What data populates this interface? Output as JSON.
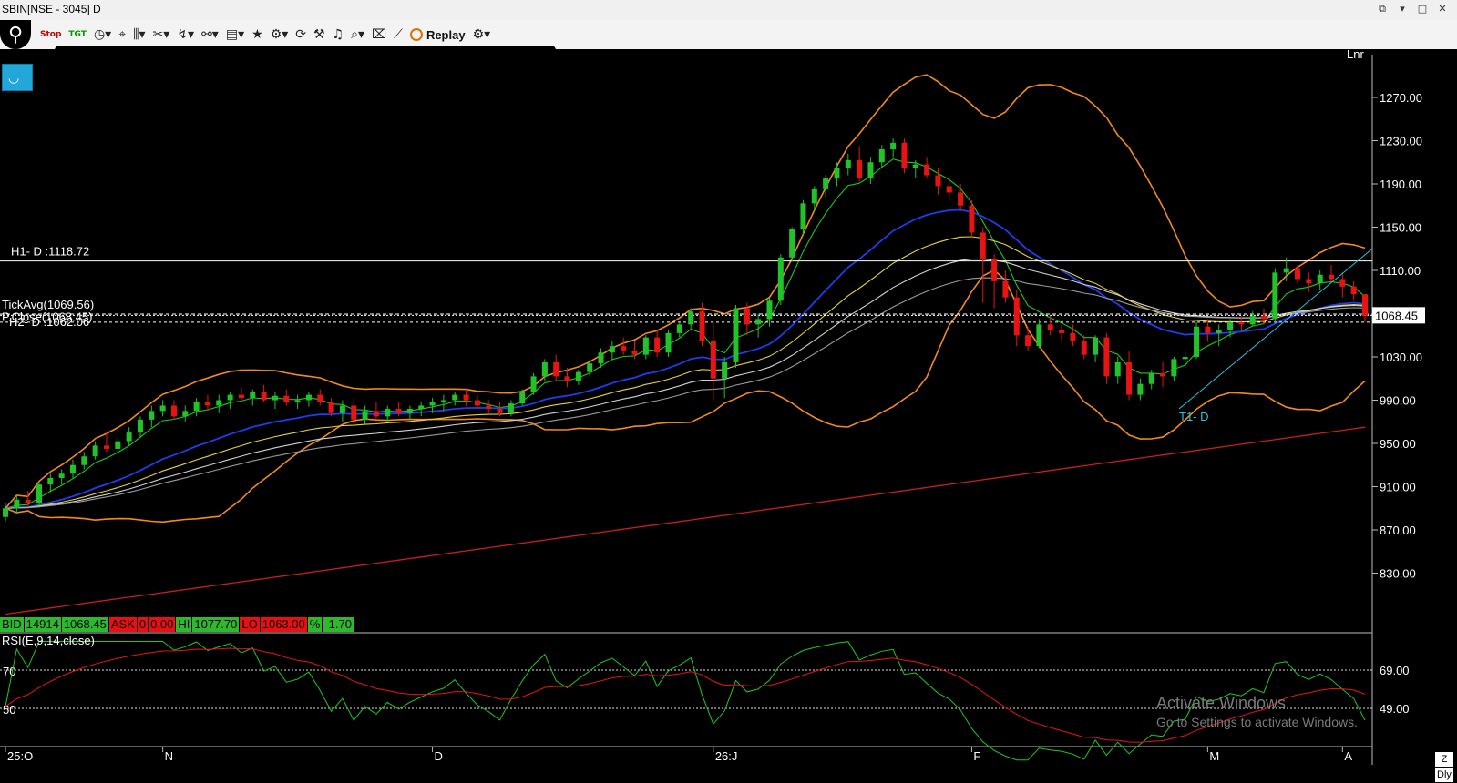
{
  "window": {
    "title": "SBIN[NSE - 3045] D"
  },
  "toolbar": {
    "stop_label": "Stop",
    "tgt_label": "TGT",
    "replay_label": "Replay",
    "icons": [
      "logo-icon",
      "clock-icon",
      "cursor-icon",
      "bars-icon",
      "scissors-icon",
      "draw-icon",
      "link-icon",
      "book-icon",
      "star-icon",
      "candle-settings-icon",
      "refresh-icon",
      "tools-icon",
      "bell-icon",
      "search-icon",
      "trash-icon",
      "chart-icon",
      "replay-icon",
      "gear-icon"
    ]
  },
  "chart": {
    "scale_label": "Lnr",
    "last_price_badge": "1068.45",
    "overlays": {
      "h1": "H1- D :1118.72",
      "tickavg": "TickAvg(1069.56)",
      "h2": "H2- D :1062.06",
      "pclose": "P.Close(1068.45)",
      "t1": "T1- D"
    }
  },
  "infobar": {
    "bid_label": "BID",
    "bid_qty": "14914",
    "bid_price": "1068.45",
    "ask_label": "ASK",
    "ask_qty": "0",
    "ask_price": "0.00",
    "hi_label": "HI",
    "hi_value": "1077.70",
    "lo_label": "LO",
    "lo_value": "1063.00",
    "pct_label": "%",
    "pct_value": "-1.70"
  },
  "rsi": {
    "label": "RSI(E,9,14,close)",
    "left_levels": [
      "70",
      "50"
    ],
    "right_levels": [
      "69.00",
      "49.00"
    ]
  },
  "xaxis": {
    "labels": [
      "25:O",
      "N",
      "D",
      "26:J",
      "F",
      "M",
      "A"
    ]
  },
  "bottom_buttons": {
    "zoom": "Z",
    "period": "Dly"
  },
  "watermark": {
    "line1": "Activate Windows",
    "line2": "Go to Settings to activate Windows."
  },
  "colors": {
    "up": "#22c22a",
    "down": "#e81414",
    "bb": "#f08a1e",
    "ema_fast": "#1ec81e",
    "ema_blue": "#1e3cf0",
    "ema_yellow": "#e6d23c",
    "ema_white": "#d2d2d2",
    "ema_red": "#c81e1e",
    "cyan": "#2fc0e0",
    "rsi_green": "#1ec81e",
    "rsi_red": "#e81414"
  },
  "chart_data": {
    "type": "candlestick",
    "symbol": "SBIN[NSE - 3045]",
    "timeframe": "D",
    "price_range": [
      790,
      1300
    ],
    "yticks": [
      830,
      870,
      910,
      950,
      990,
      1030,
      1070,
      1110,
      1150,
      1190,
      1230,
      1270
    ],
    "x_months": [
      "25:O",
      "N",
      "D",
      "26:J",
      "F",
      "M",
      "A"
    ],
    "ohlc": [
      [
        882,
        895,
        878,
        890
      ],
      [
        890,
        902,
        885,
        898
      ],
      [
        898,
        906,
        892,
        895
      ],
      [
        895,
        915,
        893,
        912
      ],
      [
        912,
        922,
        905,
        918
      ],
      [
        918,
        926,
        912,
        922
      ],
      [
        922,
        935,
        918,
        930
      ],
      [
        930,
        942,
        926,
        938
      ],
      [
        938,
        952,
        935,
        948
      ],
      [
        948,
        960,
        942,
        945
      ],
      [
        945,
        955,
        940,
        952
      ],
      [
        952,
        965,
        948,
        960
      ],
      [
        960,
        975,
        955,
        972
      ],
      [
        972,
        985,
        965,
        980
      ],
      [
        980,
        990,
        975,
        985
      ],
      [
        985,
        990,
        972,
        975
      ],
      [
        975,
        985,
        970,
        980
      ],
      [
        980,
        992,
        975,
        988
      ],
      [
        988,
        995,
        980,
        985
      ],
      [
        985,
        995,
        978,
        990
      ],
      [
        990,
        998,
        982,
        995
      ],
      [
        995,
        1002,
        988,
        992
      ],
      [
        992,
        1000,
        985,
        998
      ],
      [
        998,
        1004,
        988,
        990
      ],
      [
        990,
        998,
        982,
        994
      ],
      [
        994,
        1000,
        985,
        988
      ],
      [
        988,
        995,
        982,
        990
      ],
      [
        990,
        998,
        984,
        995
      ],
      [
        995,
        1000,
        985,
        988
      ],
      [
        988,
        992,
        975,
        978
      ],
      [
        978,
        990,
        970,
        985
      ],
      [
        985,
        992,
        968,
        972
      ],
      [
        972,
        985,
        968,
        980
      ],
      [
        980,
        988,
        972,
        975
      ],
      [
        975,
        985,
        970,
        982
      ],
      [
        982,
        988,
        975,
        978
      ],
      [
        978,
        985,
        972,
        982
      ],
      [
        982,
        988,
        975,
        985
      ],
      [
        985,
        992,
        978,
        988
      ],
      [
        988,
        995,
        980,
        990
      ],
      [
        990,
        998,
        985,
        995
      ],
      [
        995,
        1000,
        985,
        990
      ],
      [
        990,
        995,
        982,
        985
      ],
      [
        985,
        990,
        978,
        982
      ],
      [
        982,
        988,
        975,
        978
      ],
      [
        978,
        990,
        975,
        987
      ],
      [
        987,
        1000,
        985,
        998
      ],
      [
        998,
        1015,
        995,
        1012
      ],
      [
        1012,
        1028,
        1008,
        1025
      ],
      [
        1025,
        1032,
        1008,
        1012
      ],
      [
        1012,
        1020,
        1002,
        1008
      ],
      [
        1008,
        1018,
        1004,
        1016
      ],
      [
        1016,
        1028,
        1012,
        1024
      ],
      [
        1024,
        1038,
        1020,
        1034
      ],
      [
        1034,
        1045,
        1028,
        1040
      ],
      [
        1040,
        1048,
        1032,
        1036
      ],
      [
        1036,
        1045,
        1028,
        1032
      ],
      [
        1032,
        1050,
        1028,
        1048
      ],
      [
        1048,
        1055,
        1030,
        1034
      ],
      [
        1034,
        1055,
        1030,
        1052
      ],
      [
        1052,
        1062,
        1048,
        1060
      ],
      [
        1060,
        1075,
        1055,
        1072
      ],
      [
        1072,
        1080,
        1040,
        1045
      ],
      [
        1045,
        1062,
        990,
        1010
      ],
      [
        1010,
        1030,
        992,
        1025
      ],
      [
        1025,
        1078,
        1020,
        1075
      ],
      [
        1075,
        1080,
        1050,
        1060
      ],
      [
        1060,
        1070,
        1048,
        1065
      ],
      [
        1065,
        1085,
        1058,
        1082
      ],
      [
        1082,
        1125,
        1078,
        1122
      ],
      [
        1122,
        1150,
        1118,
        1148
      ],
      [
        1148,
        1175,
        1142,
        1172
      ],
      [
        1172,
        1188,
        1165,
        1185
      ],
      [
        1185,
        1198,
        1178,
        1195
      ],
      [
        1195,
        1210,
        1188,
        1205
      ],
      [
        1205,
        1218,
        1198,
        1212
      ],
      [
        1212,
        1225,
        1192,
        1195
      ],
      [
        1195,
        1215,
        1190,
        1210
      ],
      [
        1210,
        1226,
        1205,
        1222
      ],
      [
        1222,
        1232,
        1215,
        1228
      ],
      [
        1228,
        1232,
        1200,
        1205
      ],
      [
        1205,
        1212,
        1195,
        1208
      ],
      [
        1208,
        1215,
        1195,
        1198
      ],
      [
        1198,
        1205,
        1180,
        1188
      ],
      [
        1188,
        1195,
        1175,
        1182
      ],
      [
        1182,
        1190,
        1165,
        1170
      ],
      [
        1170,
        1175,
        1140,
        1145
      ],
      [
        1145,
        1150,
        1080,
        1120
      ],
      [
        1120,
        1125,
        1075,
        1100
      ],
      [
        1100,
        1110,
        1080,
        1085
      ],
      [
        1085,
        1092,
        1040,
        1050
      ],
      [
        1050,
        1058,
        1035,
        1040
      ],
      [
        1040,
        1065,
        1038,
        1060
      ],
      [
        1060,
        1068,
        1050,
        1055
      ],
      [
        1055,
        1060,
        1045,
        1052
      ],
      [
        1052,
        1060,
        1040,
        1045
      ],
      [
        1045,
        1050,
        1028,
        1032
      ],
      [
        1032,
        1050,
        1025,
        1048
      ],
      [
        1048,
        1052,
        1005,
        1012
      ],
      [
        1012,
        1030,
        1005,
        1025
      ],
      [
        1025,
        1035,
        990,
        995
      ],
      [
        995,
        1010,
        990,
        1005
      ],
      [
        1005,
        1018,
        1000,
        1015
      ],
      [
        1015,
        1025,
        1002,
        1012
      ],
      [
        1012,
        1030,
        1008,
        1028
      ],
      [
        1028,
        1035,
        1020,
        1030
      ],
      [
        1030,
        1062,
        1028,
        1058
      ],
      [
        1058,
        1065,
        1045,
        1052
      ],
      [
        1052,
        1060,
        1040,
        1055
      ],
      [
        1055,
        1065,
        1048,
        1062
      ],
      [
        1062,
        1068,
        1055,
        1060
      ],
      [
        1060,
        1072,
        1058,
        1068
      ],
      [
        1068,
        1075,
        1060,
        1065
      ],
      [
        1065,
        1112,
        1062,
        1108
      ],
      [
        1108,
        1122,
        1100,
        1112
      ],
      [
        1112,
        1115,
        1098,
        1102
      ],
      [
        1102,
        1108,
        1090,
        1098
      ],
      [
        1098,
        1110,
        1092,
        1106
      ],
      [
        1106,
        1115,
        1098,
        1102
      ],
      [
        1102,
        1108,
        1085,
        1095
      ],
      [
        1095,
        1100,
        1082,
        1088
      ],
      [
        1088,
        1078,
        1062,
        1068
      ]
    ],
    "indicators": {
      "bollinger": {
        "upper": "orange",
        "lower": "orange"
      },
      "ema_series": [
        "green",
        "blue",
        "yellow",
        "white",
        "white2",
        "red"
      ]
    },
    "levels": {
      "H1": 1118.72,
      "TickAvg": 1069.56,
      "H2": 1062.06,
      "PClose": 1068.45
    },
    "rsi_range": [
      20,
      90
    ],
    "rsi_levels": [
      69,
      49
    ]
  }
}
